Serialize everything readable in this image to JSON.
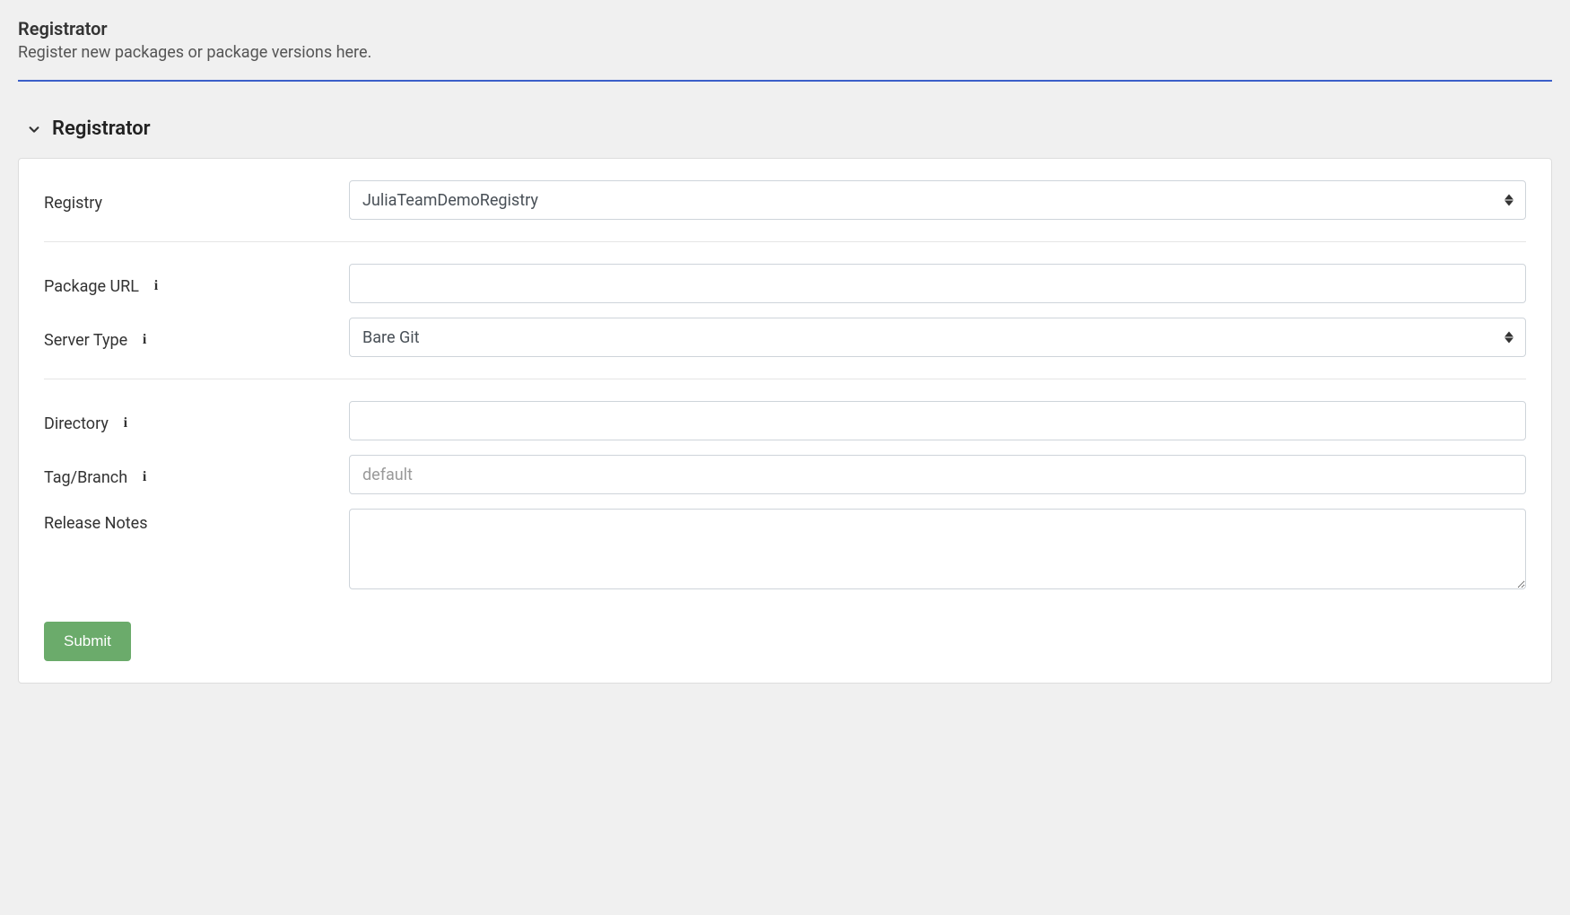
{
  "header": {
    "title": "Registrator",
    "subtitle": "Register new packages or package versions here."
  },
  "section": {
    "title": "Registrator"
  },
  "form": {
    "registry": {
      "label": "Registry",
      "value": "JuliaTeamDemoRegistry"
    },
    "package_url": {
      "label": "Package URL",
      "value": ""
    },
    "server_type": {
      "label": "Server Type",
      "value": "Bare Git"
    },
    "directory": {
      "label": "Directory",
      "value": ""
    },
    "tag_branch": {
      "label": "Tag/Branch",
      "placeholder": "default",
      "value": ""
    },
    "release_notes": {
      "label": "Release Notes",
      "value": ""
    },
    "submit_label": "Submit"
  }
}
